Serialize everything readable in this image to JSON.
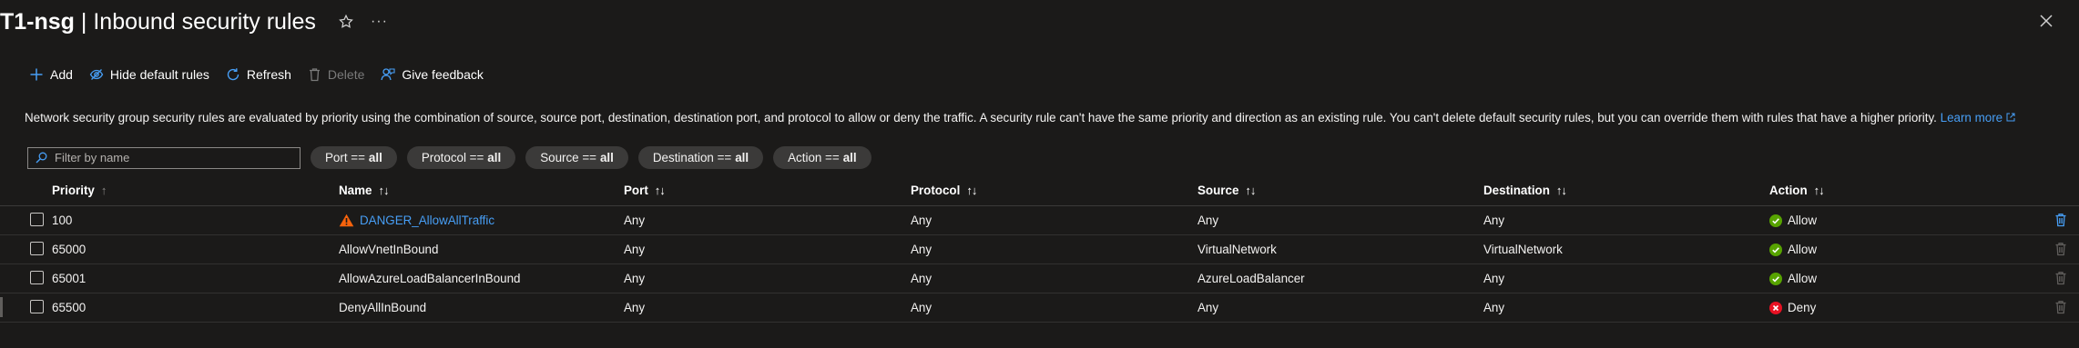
{
  "header": {
    "title_prefix": "T1-nsg",
    "title_separator": " | ",
    "title_suffix": "Inbound security rules"
  },
  "toolbar": {
    "add_label": "Add",
    "hide_default_label": "Hide default rules",
    "refresh_label": "Refresh",
    "delete_label": "Delete",
    "feedback_label": "Give feedback"
  },
  "info": {
    "text": "Network security group security rules are evaluated by priority using the combination of source, source port, destination, destination port, and protocol to allow or deny the traffic. A security rule can't have the same priority and direction as an existing rule. You can't delete default security rules, but you can override them with rules that have a higher priority.",
    "link_label": "Learn more"
  },
  "filters": {
    "search_placeholder": "Filter by name",
    "pills": [
      {
        "label": "Port ==",
        "value": "all"
      },
      {
        "label": "Protocol ==",
        "value": "all"
      },
      {
        "label": "Source ==",
        "value": "all"
      },
      {
        "label": "Destination ==",
        "value": "all"
      },
      {
        "label": "Action ==",
        "value": "all"
      }
    ]
  },
  "table": {
    "columns": {
      "priority": "Priority",
      "name": "Name",
      "port": "Port",
      "protocol": "Protocol",
      "source": "Source",
      "destination": "Destination",
      "action": "Action"
    },
    "rows": [
      {
        "priority": "100",
        "name": "DANGER_AllowAllTraffic",
        "port": "Any",
        "protocol": "Any",
        "source": "Any",
        "destination": "Any",
        "action": "Allow"
      },
      {
        "priority": "65000",
        "name": "AllowVnetInBound",
        "port": "Any",
        "protocol": "Any",
        "source": "VirtualNetwork",
        "destination": "VirtualNetwork",
        "action": "Allow"
      },
      {
        "priority": "65001",
        "name": "AllowAzureLoadBalancerInBound",
        "port": "Any",
        "protocol": "Any",
        "source": "AzureLoadBalancer",
        "destination": "Any",
        "action": "Allow"
      },
      {
        "priority": "65500",
        "name": "DenyAllInBound",
        "port": "Any",
        "protocol": "Any",
        "source": "Any",
        "destination": "Any",
        "action": "Deny"
      }
    ]
  },
  "colors": {
    "background": "#1b1a19",
    "link": "#479ef5",
    "allow": "#57a300",
    "deny": "#e81123",
    "warning": "#fce100"
  }
}
